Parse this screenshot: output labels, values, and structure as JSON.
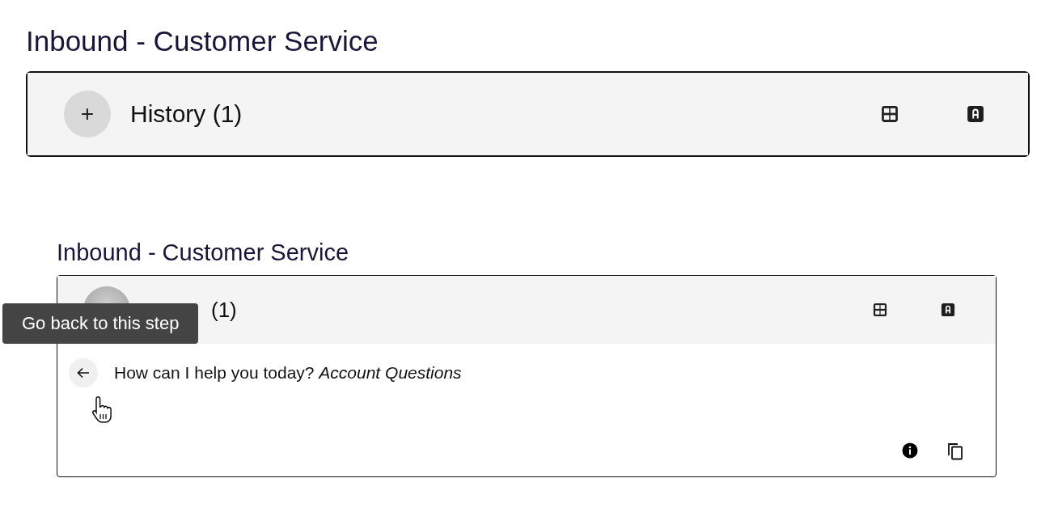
{
  "sections": [
    {
      "title": "Inbound - Customer Service",
      "header": {
        "toggle": "+",
        "label": "History (1)"
      },
      "expanded": false
    },
    {
      "title": "Inbound - Customer Service",
      "header": {
        "label": "(1)"
      },
      "expanded": true,
      "tooltip": "Go back to this step",
      "entries": [
        {
          "text": "How can I help you today? *Account Questions*"
        }
      ]
    }
  ]
}
